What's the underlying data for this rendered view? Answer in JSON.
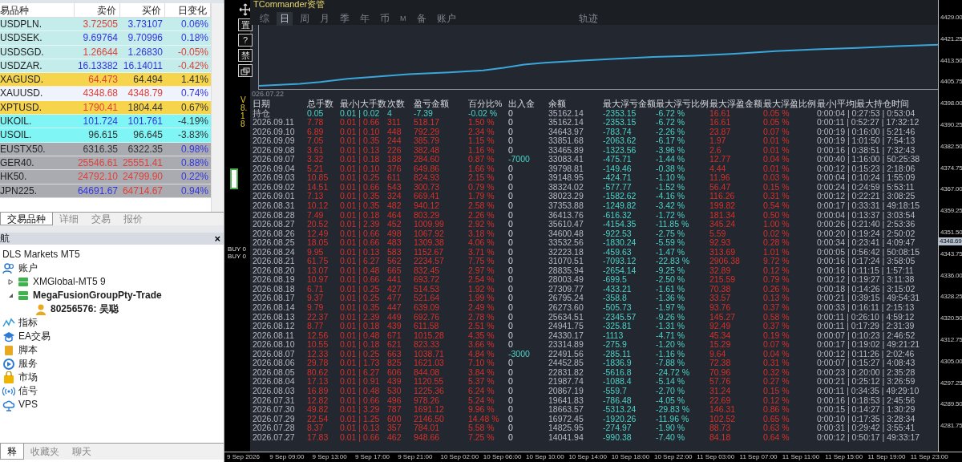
{
  "market_watch": {
    "columns": [
      "易品种",
      "卖价",
      "买价",
      "日变化"
    ],
    "rows": [
      {
        "symbol": "USDPLN.",
        "color": "#c4ecea",
        "bid": {
          "value": "3.72505",
          "rising": false,
          "falling": true
        },
        "ask": {
          "value": "3.73107",
          "rising": true,
          "falling": false
        },
        "change": {
          "value": "0.06%",
          "rising": true,
          "falling": false
        }
      },
      {
        "symbol": "USDSEK.",
        "color": "#c4ecea",
        "bid": {
          "value": "9.69764",
          "rising": true,
          "falling": false
        },
        "ask": {
          "value": "9.70996",
          "rising": true,
          "falling": false
        },
        "change": {
          "value": "0.18%",
          "rising": true,
          "falling": false
        }
      },
      {
        "symbol": "USDSGD.",
        "color": "#c4ecea",
        "bid": {
          "value": "1.26644",
          "rising": false,
          "falling": true
        },
        "ask": {
          "value": "1.26830",
          "rising": true,
          "falling": false
        },
        "change": {
          "value": "-0.05%",
          "rising": false,
          "falling": true
        }
      },
      {
        "symbol": "USDZAR.",
        "color": "#c4ecea",
        "bid": {
          "value": "16.13382",
          "rising": true,
          "falling": false
        },
        "ask": {
          "value": "16.14011",
          "rising": true,
          "falling": false
        },
        "change": {
          "value": "-0.42%",
          "rising": false,
          "falling": true
        }
      },
      {
        "symbol": "XAGUSD.",
        "color": "#f6d54c",
        "bid": {
          "value": "64.473",
          "rising": false,
          "falling": true
        },
        "ask": {
          "value": "64.494",
          "rising": false,
          "falling": false
        },
        "change": {
          "value": "1.41%",
          "rising": false,
          "falling": false
        }
      },
      {
        "symbol": "XAUUSD.",
        "color": "#eef3fc",
        "bid": {
          "value": "4348.68",
          "rising": false,
          "falling": true
        },
        "ask": {
          "value": "4348.79",
          "rising": false,
          "falling": true
        },
        "change": {
          "value": "0.74%",
          "rising": true,
          "falling": false
        }
      },
      {
        "symbol": "XPTUSD.",
        "color": "#f6d54c",
        "bid": {
          "value": "1790.41",
          "rising": false,
          "falling": true
        },
        "ask": {
          "value": "1804.44",
          "rising": false,
          "falling": false
        },
        "change": {
          "value": "0.67%",
          "rising": false,
          "falling": false
        }
      },
      {
        "symbol": "UKOIL.",
        "color": "#80f5f5",
        "bid": {
          "value": "101.724",
          "rising": true,
          "falling": false
        },
        "ask": {
          "value": "101.761",
          "rising": true,
          "falling": false
        },
        "change": {
          "value": "-4.19%",
          "rising": false,
          "falling": false
        }
      },
      {
        "symbol": "USOIL.",
        "color": "#80f5f5",
        "bid": {
          "value": "96.615",
          "rising": false,
          "falling": false
        },
        "ask": {
          "value": "96.645",
          "rising": false,
          "falling": false
        },
        "change": {
          "value": "-3.83%",
          "rising": false,
          "falling": false
        }
      },
      {
        "symbol": "EUSTX50.",
        "color": "#a9abb1",
        "bid": {
          "value": "6316.35",
          "rising": false,
          "falling": false
        },
        "ask": {
          "value": "6322.35",
          "rising": false,
          "falling": false
        },
        "change": {
          "value": "0.98%",
          "rising": true,
          "falling": false
        }
      },
      {
        "symbol": "GER40.",
        "color": "#a9abb1",
        "bid": {
          "value": "25546.61",
          "rising": false,
          "falling": true
        },
        "ask": {
          "value": "25551.41",
          "rising": false,
          "falling": true
        },
        "change": {
          "value": "0.88%",
          "rising": true,
          "falling": false
        }
      },
      {
        "symbol": "HK50.",
        "color": "#a9abb1",
        "bid": {
          "value": "24792.10",
          "rising": false,
          "falling": true
        },
        "ask": {
          "value": "24799.90",
          "rising": false,
          "falling": true
        },
        "change": {
          "value": "0.22%",
          "rising": true,
          "falling": false
        }
      },
      {
        "symbol": "JPN225.",
        "color": "#a9abb1",
        "bid": {
          "value": "64691.67",
          "rising": true,
          "falling": false
        },
        "ask": {
          "value": "64714.67",
          "rising": false,
          "falling": true
        },
        "change": {
          "value": "0.94%",
          "rising": true,
          "falling": false
        }
      }
    ],
    "tabs": [
      {
        "label": "交易品种",
        "selected": true
      },
      {
        "label": "详细",
        "selected": false
      },
      {
        "label": "交易",
        "selected": false
      },
      {
        "label": "报价",
        "selected": false
      }
    ]
  },
  "navigator": {
    "title": "航",
    "close": "×",
    "tree": [
      {
        "label": "DLS Markets MT5",
        "kind": "broker"
      },
      {
        "label": "账户",
        "kind": "accounts",
        "children": [
          {
            "label": "XMGlobal-MT5 9",
            "kind": "server",
            "expanded": false,
            "active": false
          },
          {
            "label": "MegaFusionGroupPty-Trade",
            "kind": "server",
            "expanded": true,
            "active": true,
            "children": [
              {
                "label": "80256576: 吴聪",
                "kind": "user",
                "active": true
              }
            ]
          }
        ]
      },
      {
        "label": "指标",
        "kind": "indicators"
      },
      {
        "label": "EA交易",
        "kind": "experts"
      },
      {
        "label": "脚本",
        "kind": "scripts"
      },
      {
        "label": "服务",
        "kind": "services"
      },
      {
        "label": "市场",
        "kind": "market"
      },
      {
        "label": "信号",
        "kind": "signals"
      },
      {
        "label": "VPS",
        "kind": "vps"
      }
    ],
    "tabs": [
      {
        "label": "释",
        "selected": true
      },
      {
        "label": "收藏夹",
        "selected": false
      },
      {
        "label": "聊天",
        "selected": false
      }
    ]
  },
  "chart_toolbar": {
    "buttons": [
      "置",
      "?",
      "禁"
    ],
    "version": "V8.18",
    "order_labels": [
      "BUY 0",
      "BUY 0"
    ]
  },
  "terminal": {
    "title": "TCommander资管",
    "tabs": [
      {
        "label": "综",
        "selected": false
      },
      {
        "label": "日",
        "selected": true
      },
      {
        "label": "周",
        "selected": false
      },
      {
        "label": "月",
        "selected": false
      },
      {
        "label": "季",
        "selected": false
      },
      {
        "label": "年",
        "selected": false
      },
      {
        "label": "币",
        "selected": false
      },
      {
        "label": "M",
        "selected": false
      },
      {
        "label": "备",
        "selected": false
      },
      {
        "label": "账户",
        "selected": false
      }
    ],
    "side_tab": {
      "label": "轨迹",
      "selected": false
    },
    "chart_start_label": "026.07.22",
    "stats_table": {
      "columns": [
        "日期",
        "总手数",
        "最小|大手数",
        "次数",
        "盈亏金额",
        "百分比%",
        "出入金",
        "余额",
        "最大浮亏金额",
        "最大浮亏比例",
        "最大浮盈金额",
        "最大浮盈比例",
        "最小|平均|最大持仓时间"
      ],
      "rows": [
        {
          "kind": "position",
          "flow_highlight": false,
          "cells": [
            "持仓",
            "0.05",
            "0.01 | 0.02",
            "4",
            "-7.39",
            "-0.02 %",
            "0",
            "35162.14",
            "-2353.15",
            "-6.72 %",
            "16.61",
            "0.05 %",
            "0:00:04 | 0:27:53 | 0:53:04"
          ]
        },
        {
          "kind": "day",
          "flow_highlight": false,
          "cells": [
            "2026.09.11",
            "7.78",
            "0.01 | 0.66",
            "311",
            "518.17",
            "1.50 %",
            "0",
            "35162.14",
            "-2353.15",
            "-6.72 %",
            "16.61",
            "0.05 %",
            "0:00:11 | 0:52:27 | 17:32:12"
          ]
        },
        {
          "kind": "day",
          "flow_highlight": false,
          "cells": [
            "2026.09.10",
            "6.89",
            "0.01 | 0.10",
            "448",
            "792.29",
            "2.34 %",
            "0",
            "34643.97",
            "-783.74",
            "-2.26 %",
            "23.87",
            "0.07 %",
            "0:00:19 | 0:16:00 | 5:21:46"
          ]
        },
        {
          "kind": "day",
          "flow_highlight": false,
          "cells": [
            "2026.09.09",
            "7.05",
            "0.01 | 0.35",
            "244",
            "385.79",
            "1.15 %",
            "0",
            "33851.68",
            "-2063.62",
            "-6.17 %",
            "1.97",
            "0.01 %",
            "0:00:19 | 1:01:50 | 7:54:13"
          ]
        },
        {
          "kind": "day",
          "flow_highlight": false,
          "cells": [
            "2026.09.08",
            "3.61",
            "0.01 | 0.13",
            "226",
            "382.48",
            "1.16 %",
            "0",
            "33465.89",
            "-1323.56",
            "-3.96 %",
            "2.6",
            "0.01 %",
            "0:00:16 | 0:38:51 | 7:32:43"
          ]
        },
        {
          "kind": "day",
          "flow_highlight": true,
          "cells": [
            "2026.09.07",
            "3.32",
            "0.01 | 0.18",
            "188",
            "284.60",
            "0.87 %",
            "-7000",
            "33083.41",
            "-475.71",
            "-1.44 %",
            "12.77",
            "0.04 %",
            "0:00:40 | 1:16:00 | 50:25:38"
          ]
        },
        {
          "kind": "day",
          "flow_highlight": false,
          "cells": [
            "2026.09.04",
            "5.21",
            "0.01 | 0.10",
            "376",
            "649.86",
            "1.66 %",
            "0",
            "39798.81",
            "-149.46",
            "-0.38 %",
            "4.44",
            "0.01 %",
            "0:00:12 | 0:15:23 | 2:18:06"
          ]
        },
        {
          "kind": "day",
          "flow_highlight": false,
          "cells": [
            "2026.09.03",
            "10.85",
            "0.01 | 0.25",
            "611",
            "824.93",
            "2.15 %",
            "0",
            "39148.95",
            "-424.71",
            "-1.10 %",
            "11.96",
            "0.03 %",
            "0:00:04 | 0:10:24 | 1:55:09"
          ]
        },
        {
          "kind": "day",
          "flow_highlight": false,
          "cells": [
            "2026.09.02",
            "14.51",
            "0.01 | 0.66",
            "543",
            "300.73",
            "0.79 %",
            "0",
            "38324.02",
            "-577.77",
            "-1.52 %",
            "56.47",
            "0.15 %",
            "0:00:24 | 0:24:59 | 5:53:11"
          ]
        },
        {
          "kind": "day",
          "flow_highlight": false,
          "cells": [
            "2026.09.01",
            "7.13",
            "0.01 | 0.35",
            "324",
            "669.41",
            "1.79 %",
            "0",
            "38023.29",
            "-1582.62",
            "-4.16 %",
            "116.26",
            "0.31 %",
            "0:00:12 | 0:22:21 | 3:08:25"
          ]
        },
        {
          "kind": "day",
          "flow_highlight": false,
          "cells": [
            "2026.08.31",
            "10.12",
            "0.01 | 0.35",
            "482",
            "940.12",
            "2.58 %",
            "0",
            "37353.88",
            "-1249.82",
            "-3.42 %",
            "199.82",
            "0.54 %",
            "0:00:17 | 0:33:31 | 49:18:15"
          ]
        },
        {
          "kind": "day",
          "flow_highlight": false,
          "cells": [
            "2026.08.28",
            "7.49",
            "0.01 | 0.18",
            "464",
            "803.29",
            "2.26 %",
            "0",
            "36413.76",
            "-616.32",
            "-1.72 %",
            "181.34",
            "0.50 %",
            "0:00:04 | 0:13:37 | 3:03:54"
          ]
        },
        {
          "kind": "day",
          "flow_highlight": false,
          "cells": [
            "2026.08.27",
            "20.52",
            "0.01 | 2.39",
            "452",
            "1009.99",
            "2.92 %",
            "0",
            "35610.47",
            "-4154.35",
            "-11.85 %",
            "345.24",
            "1.00 %",
            "0:00:26 | 0:21:40 | 2:53:36"
          ]
        },
        {
          "kind": "day",
          "flow_highlight": false,
          "cells": [
            "2026.08.26",
            "12.49",
            "0.01 | 0.66",
            "498",
            "1067.92",
            "3.18 %",
            "0",
            "34600.48",
            "-922.53",
            "-2.75 %",
            "5.59",
            "0.02 %",
            "0:00:20 | 0:19:24 | 2:50:02"
          ]
        },
        {
          "kind": "day",
          "flow_highlight": false,
          "cells": [
            "2026.08.25",
            "18.05",
            "0.01 | 0.66",
            "483",
            "1309.38",
            "4.06 %",
            "0",
            "33532.56",
            "-1830.24",
            "-5.59 %",
            "92.93",
            "0.28 %",
            "0:00:34 | 0:23:41 | 4:09:47"
          ]
        },
        {
          "kind": "day",
          "flow_highlight": false,
          "cells": [
            "2026.08.24",
            "9.95",
            "0.01 | 0.13",
            "583",
            "1152.67",
            "3.71 %",
            "0",
            "32223.18",
            "-459.63",
            "-1.47 %",
            "313.69",
            "1.01 %",
            "0:00:05 | 0:56:42 | 50:08:15"
          ]
        },
        {
          "kind": "day",
          "flow_highlight": false,
          "cells": [
            "2026.08.21",
            "61.75",
            "0.01 | 6.27",
            "562",
            "2234.57",
            "7.75 %",
            "0",
            "31070.51",
            "-7093.12",
            "-22.83 %",
            "2906.38",
            "9.72 %",
            "0:00:16 | 0:17:24 | 3:58:05"
          ]
        },
        {
          "kind": "day",
          "flow_highlight": false,
          "cells": [
            "2026.08.20",
            "13.07",
            "0.01 | 0.48",
            "665",
            "832.45",
            "2.97 %",
            "0",
            "28835.94",
            "-2654.14",
            "-9.25 %",
            "32.89",
            "0.12 %",
            "0:00:16 | 0:11:15 | 1:57:11"
          ]
        },
        {
          "kind": "day",
          "flow_highlight": false,
          "cells": [
            "2026.08.19",
            "10.97",
            "0.01 | 0.66",
            "441",
            "693.72",
            "2.54 %",
            "0",
            "28003.49",
            "-699.5",
            "-2.50 %",
            "215.59",
            "0.79 %",
            "0:00:12 | 0:19:27 | 3:11:38"
          ]
        },
        {
          "kind": "day",
          "flow_highlight": false,
          "cells": [
            "2026.08.18",
            "6.71",
            "0.01 | 0.25",
            "427",
            "514.53",
            "1.92 %",
            "0",
            "27309.77",
            "-433.21",
            "-1.61 %",
            "70.38",
            "0.26 %",
            "0:00:18 | 0:14:26 | 3:15:02"
          ]
        },
        {
          "kind": "day",
          "flow_highlight": false,
          "cells": [
            "2026.08.17",
            "9.37",
            "0.01 | 0.25",
            "477",
            "521.64",
            "1.99 %",
            "0",
            "26795.24",
            "-358.8",
            "-1.36 %",
            "33.57",
            "0.13 %",
            "0:00:21 | 0:39:15 | 49:54:31"
          ]
        },
        {
          "kind": "day",
          "flow_highlight": false,
          "cells": [
            "2026.08.14",
            "9.79",
            "0.01 | 0.35",
            "447",
            "639.09",
            "2.49 %",
            "0",
            "26273.60",
            "-505.73",
            "-1.97 %",
            "93.76",
            "0.37 %",
            "0:00:33 | 0:16:11 | 2:15:13"
          ]
        },
        {
          "kind": "day",
          "flow_highlight": false,
          "cells": [
            "2026.08.13",
            "22.37",
            "0.01 | 2.39",
            "449",
            "692.76",
            "2.78 %",
            "0",
            "25634.51",
            "-2345.57",
            "-9.26 %",
            "145.27",
            "0.58 %",
            "0:00:11 | 0:26:10 | 4:59:12"
          ]
        },
        {
          "kind": "day",
          "flow_highlight": false,
          "cells": [
            "2026.08.12",
            "8.77",
            "0.01 | 0.18",
            "439",
            "611.58",
            "2.51 %",
            "0",
            "24941.75",
            "-325.81",
            "-1.31 %",
            "92.49",
            "0.37 %",
            "0:00:11 | 0:17:29 | 2:31:39"
          ]
        },
        {
          "kind": "day",
          "flow_highlight": false,
          "cells": [
            "2026.08.11",
            "12.56",
            "0.01 | 0.48",
            "671",
            "1015.28",
            "4.35 %",
            "0",
            "24330.17",
            "-1113",
            "-4.71 %",
            "45.34",
            "0.19 %",
            "0:00:07 | 0:10:23 | 2:46:52"
          ]
        },
        {
          "kind": "day",
          "flow_highlight": false,
          "cells": [
            "2026.08.10",
            "10.55",
            "0.01 | 0.18",
            "621",
            "823.33",
            "3.66 %",
            "0",
            "23314.89",
            "-275.9",
            "-1.20 %",
            "15.29",
            "0.07 %",
            "0:00:17 | 0:19:02 | 49:21:21"
          ]
        },
        {
          "kind": "day",
          "flow_highlight": true,
          "cells": [
            "2026.08.07",
            "12.33",
            "0.01 | 0.25",
            "663",
            "1038.71",
            "4.84 %",
            "-3000",
            "22491.56",
            "-285.11",
            "-1.16 %",
            "9.64",
            "0.04 %",
            "0:00:12 | 0:11:26 | 2:02:46"
          ]
        },
        {
          "kind": "day",
          "flow_highlight": false,
          "cells": [
            "2026.08.06",
            "29.78",
            "0.01 | 1.73",
            "825",
            "1621.03",
            "7.10 %",
            "0",
            "24452.85",
            "-1836.9",
            "-7.88 %",
            "72.38",
            "0.31 %",
            "0:00:07 | 0:15:27 | 4:08:43"
          ]
        },
        {
          "kind": "day",
          "flow_highlight": false,
          "cells": [
            "2026.08.05",
            "80.62",
            "0.01 | 6.27",
            "606",
            "844.08",
            "3.84 %",
            "0",
            "22831.82",
            "-5616.8",
            "-24.72 %",
            "70.96",
            "0.32 %",
            "0:00:23 | 0:20:00 | 2:35:28"
          ]
        },
        {
          "kind": "day",
          "flow_highlight": false,
          "cells": [
            "2026.08.04",
            "17.13",
            "0.01 | 0.91",
            "439",
            "1120.55",
            "5.37 %",
            "0",
            "21987.74",
            "-1088.4",
            "-5.14 %",
            "57.76",
            "0.27 %",
            "0:00:21 | 0:25:12 | 3:26:59"
          ]
        },
        {
          "kind": "day",
          "flow_highlight": false,
          "cells": [
            "2026.08.03",
            "16.89",
            "0.01 | 0.48",
            "530",
            "1225.36",
            "6.24 %",
            "0",
            "20867.19",
            "-559.7",
            "-2.70 %",
            "31.24",
            "0.15 %",
            "0:00:11 | 0:34:35 | 49:29:10"
          ]
        },
        {
          "kind": "day",
          "flow_highlight": false,
          "cells": [
            "2026.07.31",
            "12.82",
            "0.01 | 0.66",
            "496",
            "978.26",
            "5.24 %",
            "0",
            "19641.83",
            "-786.48",
            "-4.05 %",
            "22.69",
            "0.12 %",
            "0:00:16 | 0:18:53 | 2:45:56"
          ]
        },
        {
          "kind": "day",
          "flow_highlight": false,
          "cells": [
            "2026.07.30",
            "49.82",
            "0.01 | 3.29",
            "787",
            "1691.12",
            "9.96 %",
            "0",
            "18663.57",
            "-5313.24",
            "-29.83 %",
            "146.31",
            "0.86 %",
            "0:00:15 | 0:14:27 | 1:30:29"
          ]
        },
        {
          "kind": "day",
          "flow_highlight": false,
          "cells": [
            "2026.07.29",
            "22.54",
            "0.01 | 1.25",
            "600",
            "2146.50",
            "14.48 %",
            "0",
            "16972.45",
            "-1920.26",
            "-11.96 %",
            "102.52",
            "0.65 %",
            "0:00:10 | 0:17:35 | 3:28:34"
          ]
        },
        {
          "kind": "day",
          "flow_highlight": false,
          "cells": [
            "2026.07.28",
            "8.37",
            "0.01 | 0.13",
            "357",
            "784.01",
            "5.58 %",
            "0",
            "14825.95",
            "-274.97",
            "-1.90 %",
            "88.73",
            "0.63 %",
            "0:00:31 | 0:29:42 | 3:55:41"
          ]
        },
        {
          "kind": "day",
          "flow_highlight": false,
          "cells": [
            "2026.07.27",
            "17.83",
            "0.01 | 0.66",
            "462",
            "948.66",
            "7.25 %",
            "0",
            "14041.94",
            "-990.38",
            "-7.40 %",
            "84.18",
            "0.64 %",
            "0:00:12 | 0:50:17 | 49:33:17"
          ]
        }
      ]
    }
  },
  "price_axis": {
    "ticks": [
      "4429.00",
      "4421.25",
      "4413.50",
      "4405.75",
      "4398.00",
      "4390.25",
      "4382.50",
      "4374.75",
      "4367.00",
      "4359.25",
      "4351.50",
      "4343.75",
      "4336.00",
      "4328.25",
      "4320.50",
      "4312.75",
      "4305.00",
      "4297.25",
      "4289.50",
      "4281.75"
    ],
    "current_price": "4348.69"
  },
  "time_axis": {
    "labels": [
      "9 Sep 2026",
      "9 Sep 09:00",
      "9 Sep 13:00",
      "9 Sep 17:00",
      "9 Sep 21:00",
      "10 Sep 02:00",
      "10 Sep 06:00",
      "10 Sep 10:00",
      "10 Sep 14:00",
      "10 Sep 18:00",
      "10 Sep 22:00",
      "11 Sep 03:00",
      "11 Sep 07:00",
      "11 Sep 11:00",
      "11 Sep 15:00",
      "11 Sep 19:00",
      "11 Sep 23:00"
    ]
  }
}
